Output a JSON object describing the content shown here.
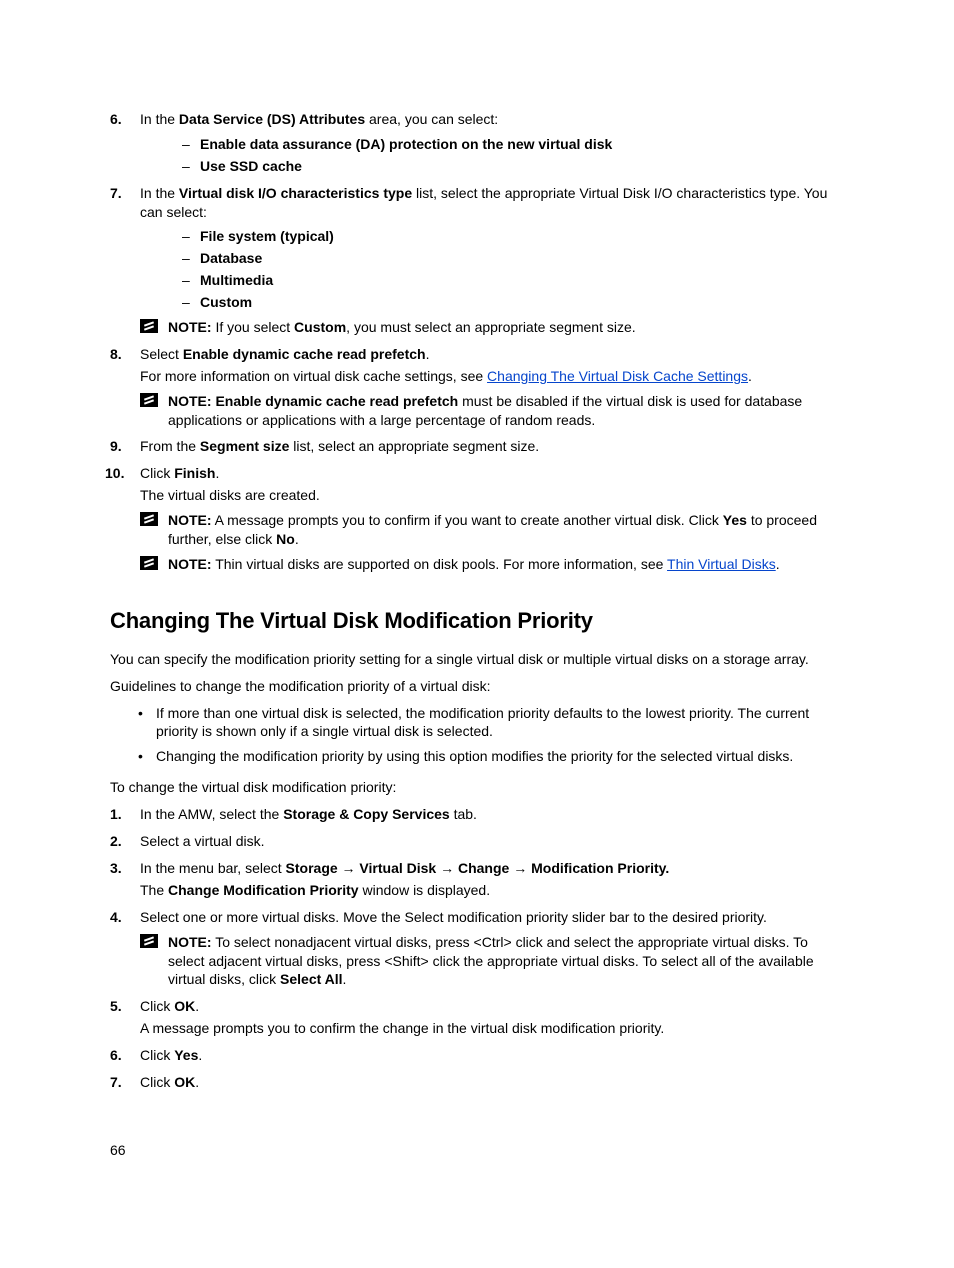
{
  "steps_a": {
    "s6": {
      "num": "6.",
      "text_a": "In the ",
      "bold_a": "Data Service (DS) Attributes",
      "text_b": " area, you can select:",
      "opts": [
        "Enable data assurance (DA) protection on the new virtual disk",
        "Use SSD cache"
      ]
    },
    "s7": {
      "num": "7.",
      "text_a": "In the ",
      "bold_a": "Virtual disk I/O characteristics type",
      "text_b": " list, select the appropriate Virtual Disk I/O characteristics type. You can select:",
      "opts": [
        "File system (typical)",
        "Database",
        "Multimedia",
        "Custom"
      ],
      "note": {
        "label": "NOTE:",
        "text_a": " If you select ",
        "bold_a": "Custom",
        "text_b": ", you must select an appropriate segment size."
      }
    },
    "s8": {
      "num": "8.",
      "text_a": "Select ",
      "bold_a": "Enable dynamic cache read prefetch",
      "text_b": ".",
      "cont_a": "For more information on virtual disk cache settings, see ",
      "link": "Changing The Virtual Disk Cache Settings",
      "cont_b": ".",
      "note": {
        "label": "NOTE:",
        "bold_a": " Enable dynamic cache read prefetch",
        "text_a": " must be disabled if the virtual disk is used for database applications or applications with a large percentage of random reads."
      }
    },
    "s9": {
      "num": "9.",
      "text_a": "From the ",
      "bold_a": "Segment size",
      "text_b": " list, select an appropriate segment size."
    },
    "s10": {
      "num": "10.",
      "text_a": "Click ",
      "bold_a": "Finish",
      "text_b": ".",
      "cont_a": "The virtual disks are created.",
      "note1": {
        "label": "NOTE:",
        "text_a": " A message prompts you to confirm if you want to create another virtual disk. Click ",
        "bold_a": "Yes",
        "text_b": " to proceed further, else click ",
        "bold_b": "No",
        "text_c": "."
      },
      "note2": {
        "label": "NOTE:",
        "text_a": " Thin virtual disks are supported on disk pools. For more information, see ",
        "link": "Thin Virtual Disks",
        "text_b": "."
      }
    }
  },
  "section_heading": "Changing The Virtual Disk Modification Priority",
  "para1": "You can specify the modification priority setting for a single virtual disk or multiple virtual disks on a storage array.",
  "para2": "Guidelines to change the modification priority of a virtual disk:",
  "guidelines": [
    "If more than one virtual disk is selected, the modification priority defaults to the lowest priority. The current priority is shown only if a single virtual disk is selected.",
    "Changing the modification priority by using this option modifies the priority for the selected virtual disks."
  ],
  "para3": "To change the virtual disk modification priority:",
  "steps_b": {
    "s1": {
      "num": "1.",
      "text_a": "In the AMW, select the ",
      "bold_a": "Storage & Copy Services",
      "text_b": " tab."
    },
    "s2": {
      "num": "2.",
      "text_a": "Select a virtual disk."
    },
    "s3": {
      "num": "3.",
      "text_a": "In the menu bar, select ",
      "bold_a": "Storage → Virtual Disk → Change → Modification Priority.",
      "cont_a": "The ",
      "bold_b": "Change Modification Priority",
      "cont_b": " window is displayed."
    },
    "s4": {
      "num": "4.",
      "text_a": "Select one or more virtual disks. Move the Select modification priority slider bar to the desired priority.",
      "note": {
        "label": "NOTE:",
        "text_a": " To select nonadjacent virtual disks, press <Ctrl> click and select the appropriate virtual disks. To select adjacent virtual disks, press <Shift> click the appropriate virtual disks. To select all of the available virtual disks, click ",
        "bold_a": "Select All",
        "text_b": "."
      }
    },
    "s5": {
      "num": "5.",
      "text_a": "Click ",
      "bold_a": "OK",
      "text_b": ".",
      "cont_a": "A message prompts you to confirm the change in the virtual disk modification priority."
    },
    "s6": {
      "num": "6.",
      "text_a": "Click ",
      "bold_a": "Yes",
      "text_b": "."
    },
    "s7": {
      "num": "7.",
      "text_a": "Click ",
      "bold_a": "OK",
      "text_b": "."
    }
  },
  "page_number": "66"
}
